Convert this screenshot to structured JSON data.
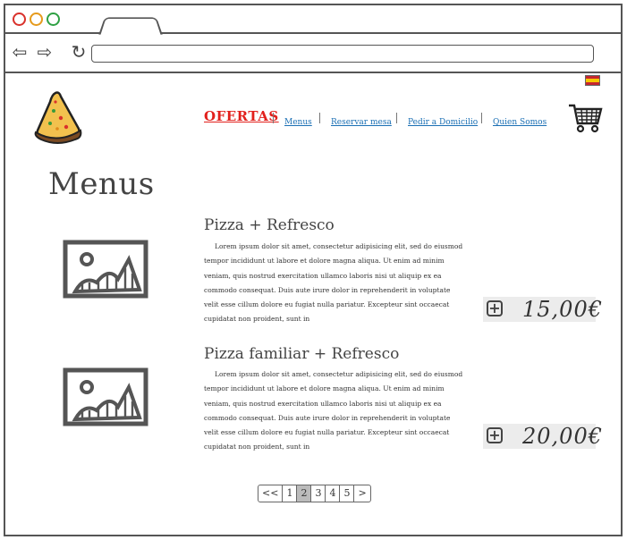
{
  "browser": {
    "back_icon": "arrow-left-icon",
    "forward_icon": "arrow-right-icon",
    "reload_icon": "reload-icon"
  },
  "nav": {
    "ofertas": "OFERTAS",
    "menus": "Menus",
    "reservar": "Reservar mesa",
    "domicilio": "Pedir a Domicilio",
    "quienes": "Quien Somos"
  },
  "page": {
    "title": "Menus"
  },
  "items": [
    {
      "title": "Pizza + Refresco",
      "description": "Lorem ipsum dolor sit amet, consectetur adipisicing elit, sed do eiusmod tempor incididunt ut labore et dolore magna aliqua. Ut enim ad minim veniam, quis nostrud exercitation ullamco laboris nisi ut aliquip ex ea commodo consequat. Duis aute irure dolor in reprehenderit in voluptate velit esse cillum dolore eu fugiat nulla pariatur. Excepteur sint occaecat cupidatat non proident, sunt in",
      "price": "15,00€"
    },
    {
      "title": "Pizza familiar + Refresco",
      "description": "Lorem ipsum dolor sit amet, consectetur adipisicing elit, sed do eiusmod tempor incididunt ut labore et dolore magna aliqua. Ut enim ad minim veniam, quis nostrud exercitation ullamco laboris nisi ut aliquip ex ea commodo consequat. Duis aute irure dolor in reprehenderit in voluptate velit esse cillum dolore eu fugiat nulla pariatur. Excepteur sint occaecat cupidatat non proident, sunt in",
      "price": "20,00€"
    }
  ],
  "pagination": {
    "prev": "<<",
    "pages": [
      "1",
      "2",
      "3",
      "4",
      "5"
    ],
    "current": "2",
    "next": ">"
  },
  "colors": {
    "ofertas": "#e2201c",
    "link": "#1a6fb4",
    "price_bg": "#ececec"
  }
}
